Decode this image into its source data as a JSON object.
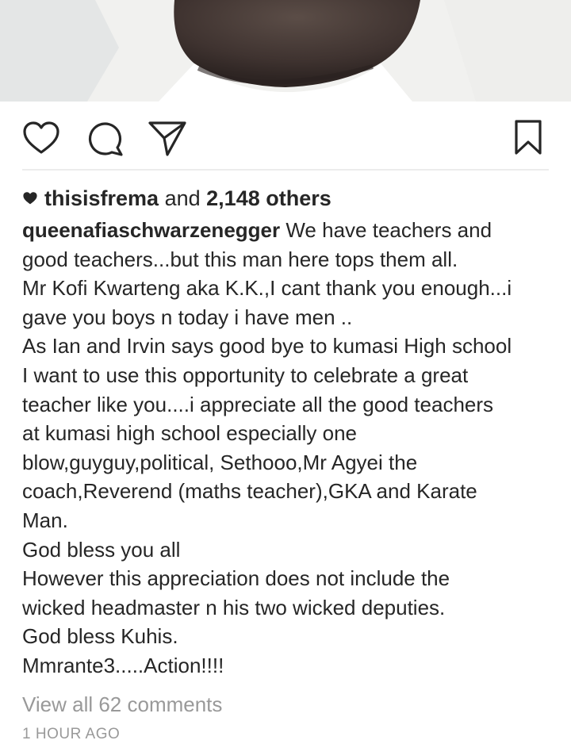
{
  "post": {
    "likes": {
      "liker": "thisisfrema",
      "connector": "and",
      "others": "2,148 others"
    },
    "caption": {
      "username": "queenafiaschwarzenegger",
      "lines": [
        "We have teachers and",
        "good teachers...but this man here tops them all.",
        "Mr Kofi Kwarteng aka K.K.,I cant thank you enough...i",
        "gave you boys n today i have men ..",
        "As Ian and Irvin says good bye to kumasi High school",
        "I want to use this opportunity to celebrate a great",
        "teacher like you....i appreciate all the good teachers",
        "at kumasi high school especially one",
        "blow,guyguy,political, Sethooo,Mr Agyei the",
        "coach,Reverend (maths teacher),GKA and Karate",
        "Man.",
        "God bless you all",
        "However this appreciation does not include the",
        "wicked headmaster n his two wicked deputies.",
        "God bless Kuhis.",
        "Mmrante3.....Action!!!!"
      ]
    },
    "view_comments": "View all 62 comments",
    "timestamp": "1 HOUR AGO"
  },
  "icons": {
    "like": "heart-outline-icon",
    "comment": "speech-bubble-icon",
    "share": "paper-plane-icon",
    "save": "bookmark-icon",
    "likes_indicator": "heart-filled-icon"
  },
  "colors": {
    "text": "#262626",
    "secondary_text": "#999999",
    "divider": "#ececec"
  }
}
